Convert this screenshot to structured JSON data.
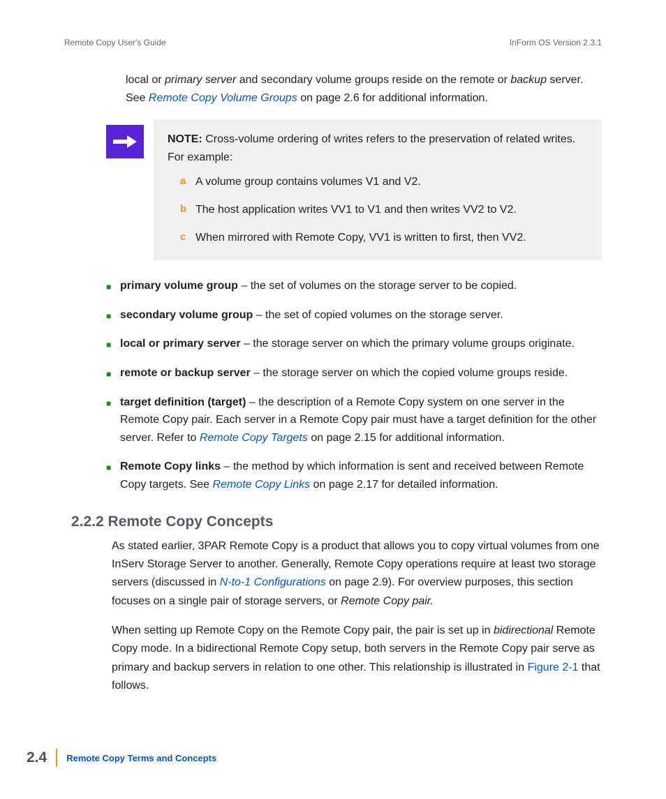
{
  "header": {
    "left": "Remote Copy User's Guide",
    "right": "InForm OS Version 2.3.1"
  },
  "intro": {
    "t1": "local or ",
    "i1": "primary server",
    "t2": " and secondary volume groups reside on the remote or ",
    "i2": "backup",
    "t3": " server. See ",
    "link1": "Remote Copy Volume Groups",
    "t4": " on page 2.6 for additional information."
  },
  "note": {
    "label": "NOTE:",
    "lead": " Cross-volume ordering of writes refers to the preservation of related writes. For example:",
    "items": [
      {
        "m": "a",
        "t": "A volume group contains volumes V1 and V2."
      },
      {
        "m": "b",
        "t": "The host application writes VV1 to V1 and then writes VV2 to V2."
      },
      {
        "m": "c",
        "t": "When mirrored with Remote Copy, VV1 is written to first, then VV2."
      }
    ]
  },
  "defs": [
    {
      "term": "primary volume group",
      "rest": " – the set of volumes on the storage server to be copied."
    },
    {
      "term": "secondary volume group",
      "rest": " – the set of copied volumes on the storage server."
    },
    {
      "term": "local or primary server",
      "rest": " – the storage server on which the primary volume groups originate."
    },
    {
      "term": "remote or backup server",
      "rest": " – the storage server on which the copied volume groups reside."
    },
    {
      "term": "target definition (target)",
      "rest1": " – the description of a Remote Copy system on one server in the Remote Copy pair. Each server in a Remote Copy pair must have a target definition for the other server. Refer to ",
      "link": "Remote Copy Targets",
      "rest2": " on page 2.15 for additional information."
    },
    {
      "term": "Remote Copy links",
      "rest1": " – the method by which information is sent and received between Remote Copy targets. See ",
      "link": "Remote Copy Links",
      "rest2": " on page 2.17 for detailed information."
    }
  ],
  "section": {
    "heading": "2.2.2 Remote Copy Concepts"
  },
  "p1": {
    "a": "As stated earlier, 3PAR Remote Copy is a product that allows you to copy virtual volumes from one InServ Storage Server to another. Generally, Remote Copy operations require at least two storage servers (discussed in ",
    "link": "N-to-1 Configurations",
    "b": " on page 2.9). For overview purposes, this section focuses on a single pair of storage servers, or ",
    "i": "Remote Copy pair.",
    "c": ""
  },
  "p2": {
    "a": "When setting up Remote Copy on the Remote Copy pair, the pair is set up in ",
    "i": "bidirectional",
    "b": " Remote Copy mode. In a bidirectional Remote Copy setup, both servers in the Remote Copy pair serve as primary and backup servers in relation to one other. This relationship is illustrated in ",
    "link": "Figure 2-1",
    "c": " that follows."
  },
  "footer": {
    "page": "2.4",
    "title": "Remote Copy Terms and Concepts"
  }
}
